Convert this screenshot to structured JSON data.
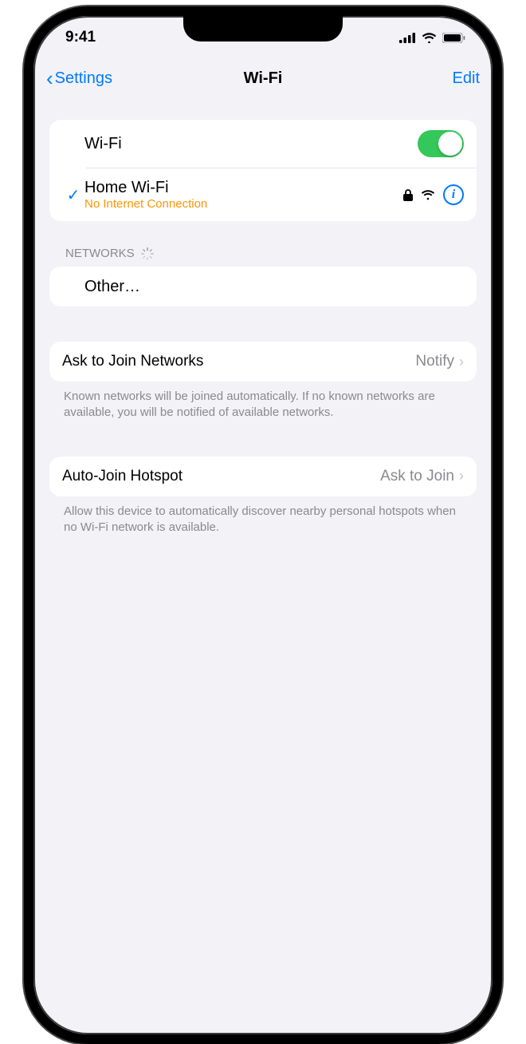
{
  "status": {
    "time": "9:41"
  },
  "nav": {
    "back": "Settings",
    "title": "Wi-Fi",
    "edit": "Edit"
  },
  "wifi": {
    "label": "Wi-Fi",
    "connected_name": "Home Wi-Fi",
    "connected_status": "No Internet Connection"
  },
  "networks": {
    "header": "Networks",
    "other": "Other…"
  },
  "ask": {
    "label": "Ask to Join Networks",
    "value": "Notify",
    "footer": "Known networks will be joined automatically. If no known networks are available, you will be notified of available networks."
  },
  "hotspot": {
    "label": "Auto-Join Hotspot",
    "value": "Ask to Join",
    "footer": "Allow this device to automatically discover nearby personal hotspots when no Wi-Fi network is available."
  }
}
